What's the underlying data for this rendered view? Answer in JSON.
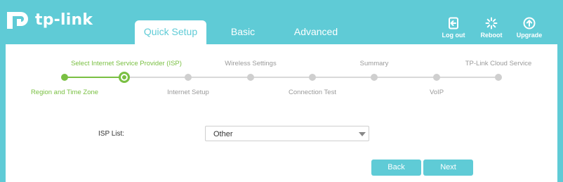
{
  "brand": {
    "name": "tp-link"
  },
  "tabs": [
    {
      "label": "Quick Setup",
      "active": true
    },
    {
      "label": "Basic",
      "active": false
    },
    {
      "label": "Advanced",
      "active": false
    }
  ],
  "actions": {
    "logout": "Log out",
    "reboot": "Reboot",
    "upgrade": "Upgrade"
  },
  "steps": [
    {
      "label": "Region and Time Zone",
      "state": "done"
    },
    {
      "label": "Select Internet Service Provider (ISP)",
      "state": "current"
    },
    {
      "label": "Internet Setup",
      "state": "todo"
    },
    {
      "label": "Wireless Settings",
      "state": "todo"
    },
    {
      "label": "Connection Test",
      "state": "todo"
    },
    {
      "label": "Summary",
      "state": "todo"
    },
    {
      "label": "VoIP",
      "state": "todo"
    },
    {
      "label": "TP-Link Cloud Service",
      "state": "todo"
    }
  ],
  "form": {
    "isp_label": "ISP List:",
    "isp_value": "Other"
  },
  "buttons": {
    "back": "Back",
    "next": "Next"
  },
  "colors": {
    "accent": "#5fcbd6",
    "progress": "#7ac043",
    "inactive": "#cfcfcf"
  }
}
